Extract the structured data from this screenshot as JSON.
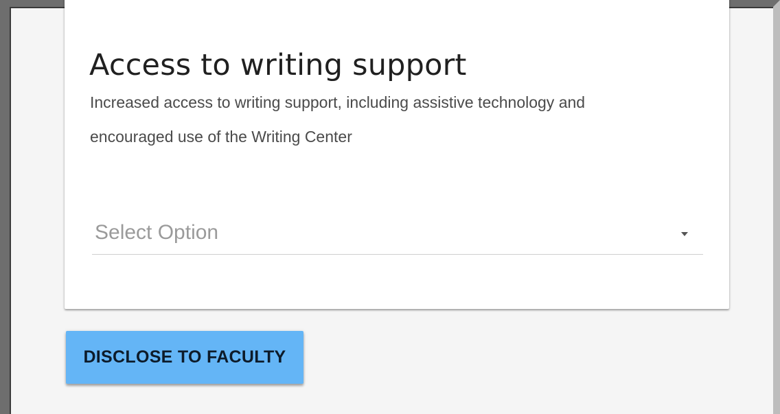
{
  "card": {
    "title": "Access to writing support",
    "description": "Increased access to writing support, including assistive technology and encouraged use of the Writing Center"
  },
  "select": {
    "placeholder": "Select Option",
    "icon": "caret-down-icon"
  },
  "actions": {
    "disclose_label": "DISCLOSE TO FACULTY"
  },
  "colors": {
    "button_background": "#64b5f6",
    "page_background": "#f5f5f5",
    "card_background": "#ffffff"
  }
}
